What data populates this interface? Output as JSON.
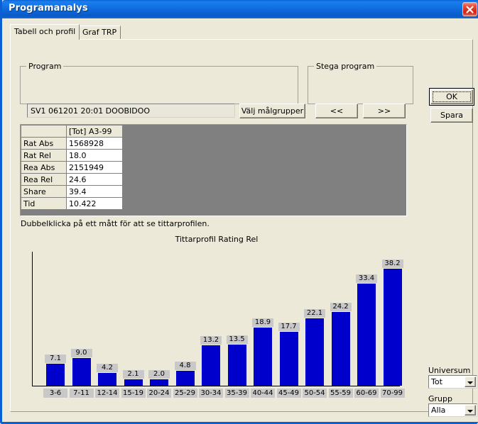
{
  "window": {
    "title": "Programanalys",
    "close_icon": "close-icon",
    "accent_color": "#0a5fd4",
    "face_color": "#ece9d8"
  },
  "tabs": [
    {
      "label": "Tabell och profil",
      "active": true
    },
    {
      "label": "Graf TRP",
      "active": false
    }
  ],
  "program_group": {
    "title": "Program",
    "field_value": "SV1 061201 20:01 DOOBIDOO",
    "field_placeholder": "",
    "select_button": "Välj målgrupper"
  },
  "step_group": {
    "title": "Stega program",
    "prev_button": "<<",
    "next_button": ">>"
  },
  "actions": {
    "ok_button": "OK",
    "save_button": "Spara"
  },
  "table": {
    "corner": "",
    "column_header": "[Tot] A3-99",
    "rows": [
      {
        "label": "Rat Abs",
        "value": "1568928"
      },
      {
        "label": "Rat Rel",
        "value": "18.0"
      },
      {
        "label": "Rea Abs",
        "value": "2151949"
      },
      {
        "label": "Rea Rel",
        "value": "24.6"
      },
      {
        "label": "Share",
        "value": "39.4"
      },
      {
        "label": "Tid",
        "value": "10.422"
      }
    ]
  },
  "hint": "Dubbelklicka på ett mått för att se tittarprofilen.",
  "chart_data": {
    "type": "bar",
    "title": "Tittarprofil Rating Rel",
    "xlabel": "",
    "ylabel": "",
    "ylim": [
      0,
      44
    ],
    "grid": false,
    "legend": "none",
    "bar_color": "#0000cc",
    "label_background": "#c8c8c8",
    "categories": [
      "3-6",
      "7-11",
      "12-14",
      "15-19",
      "20-24",
      "25-29",
      "30-34",
      "35-39",
      "40-44",
      "45-49",
      "50-54",
      "55-59",
      "60-69",
      "70-99"
    ],
    "values": [
      7.1,
      9.0,
      4.2,
      2.1,
      2.0,
      4.8,
      13.2,
      13.5,
      18.9,
      17.7,
      22.1,
      24.2,
      33.4,
      38.2
    ],
    "value_labels": [
      "7.1",
      "9.0",
      "4.2",
      "2.1",
      "2.0",
      "4.8",
      "13.2",
      "13.5",
      "18.9",
      "17.7",
      "22.1",
      "24.2",
      "33.4",
      "38.2"
    ]
  },
  "filters": {
    "universum_label": "Universum",
    "universum_value": "Tot",
    "grupp_label": "Grupp",
    "grupp_value": "Alla"
  }
}
